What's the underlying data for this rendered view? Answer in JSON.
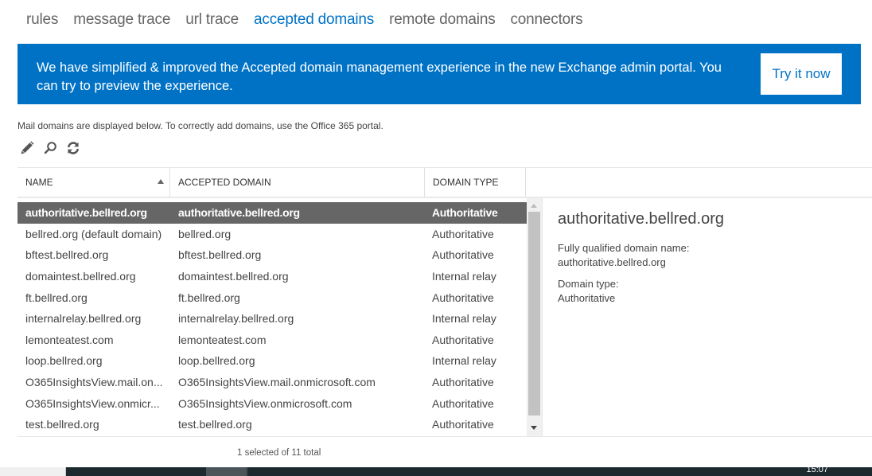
{
  "nav": {
    "tabs": [
      {
        "label": "rules",
        "active": false
      },
      {
        "label": "message trace",
        "active": false
      },
      {
        "label": "url trace",
        "active": false
      },
      {
        "label": "accepted domains",
        "active": true
      },
      {
        "label": "remote domains",
        "active": false
      },
      {
        "label": "connectors",
        "active": false
      }
    ]
  },
  "banner": {
    "message": "We have simplified & improved the Accepted domain management experience in the new Exchange admin portal. You can try to preview the experience.",
    "button_label": "Try it now"
  },
  "info_text": "Mail domains are displayed below. To correctly add domains, use the Office 365 portal.",
  "toolbar": {
    "icons": [
      "edit-icon",
      "search-icon",
      "refresh-icon"
    ]
  },
  "table": {
    "columns": [
      "NAME",
      "ACCEPTED DOMAIN",
      "DOMAIN TYPE"
    ],
    "sort_column": "NAME",
    "sort_direction": "ascending",
    "rows": [
      {
        "name": "authoritative.bellred.org",
        "domain": "authoritative.bellred.org",
        "type": "Authoritative",
        "selected": true
      },
      {
        "name": "bellred.org (default domain)",
        "domain": "bellred.org",
        "type": "Authoritative",
        "selected": false
      },
      {
        "name": "bftest.bellred.org",
        "domain": "bftest.bellred.org",
        "type": "Authoritative",
        "selected": false
      },
      {
        "name": "domaintest.bellred.org",
        "domain": "domaintest.bellred.org",
        "type": "Internal relay",
        "selected": false
      },
      {
        "name": "ft.bellred.org",
        "domain": "ft.bellred.org",
        "type": "Authoritative",
        "selected": false
      },
      {
        "name": "internalrelay.bellred.org",
        "domain": "internalrelay.bellred.org",
        "type": "Internal relay",
        "selected": false
      },
      {
        "name": "lemonteatest.com",
        "domain": "lemonteatest.com",
        "type": "Authoritative",
        "selected": false
      },
      {
        "name": "loop.bellred.org",
        "domain": "loop.bellred.org",
        "type": "Internal relay",
        "selected": false
      },
      {
        "name": "O365InsightsView.mail.on...",
        "domain": "O365InsightsView.mail.onmicrosoft.com",
        "type": "Authoritative",
        "selected": false
      },
      {
        "name": "O365InsightsView.onmicr...",
        "domain": "O365InsightsView.onmicrosoft.com",
        "type": "Authoritative",
        "selected": false
      },
      {
        "name": "test.bellred.org",
        "domain": "test.bellred.org",
        "type": "Authoritative",
        "selected": false
      }
    ]
  },
  "details": {
    "title": "authoritative.bellred.org",
    "fqdn_label": "Fully qualified domain name:",
    "fqdn_value": "authoritative.bellred.org",
    "type_label": "Domain type:",
    "type_value": "Authoritative"
  },
  "status_text": "1 selected of 11 total",
  "taskbar": {
    "clock": "15:07"
  },
  "colors": {
    "accent": "#0072c6",
    "selected_row": "#666666"
  }
}
